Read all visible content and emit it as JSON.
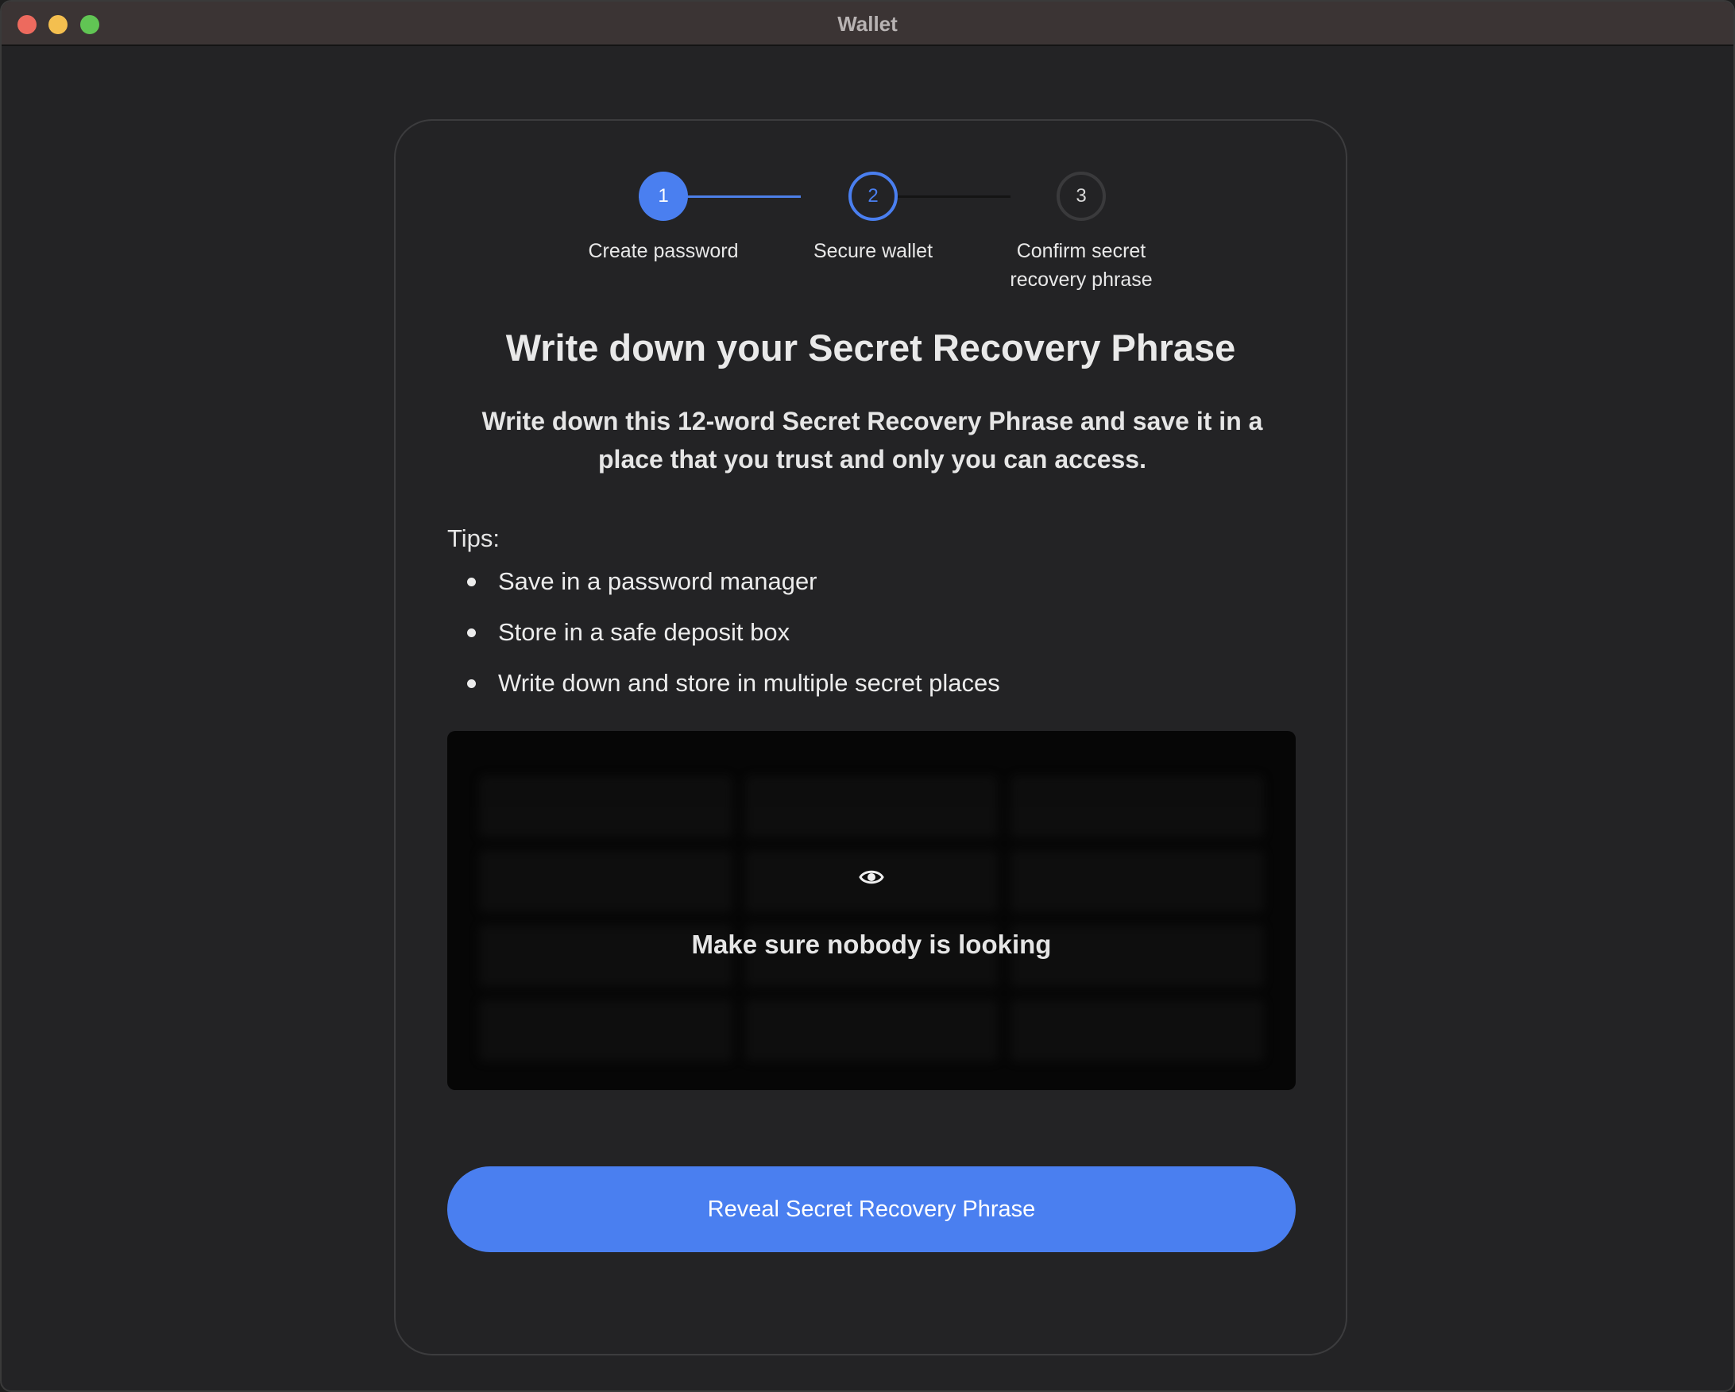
{
  "window": {
    "title": "Wallet"
  },
  "stepper": {
    "steps": [
      {
        "number": "1",
        "label": "Create password"
      },
      {
        "number": "2",
        "label": "Secure wallet"
      },
      {
        "number": "3",
        "label": "Confirm secret recovery phrase"
      }
    ],
    "current_step": 2
  },
  "main": {
    "heading": "Write down your Secret Recovery Phrase",
    "subtitle": "Write down this 12-word Secret Recovery Phrase and save it in a place that you trust and only you can access.",
    "tips_label": "Tips:",
    "tips": [
      "Save in a password manager",
      "Store in a safe deposit box",
      "Write down and store in multiple secret places"
    ]
  },
  "phrase_box": {
    "icon": "eye-icon",
    "message": "Make sure nobody is looking"
  },
  "actions": {
    "reveal_label": "Reveal Secret Recovery Phrase"
  },
  "colors": {
    "accent": "#4a7ff0",
    "background": "#232325",
    "phrase_box": "#060606"
  }
}
